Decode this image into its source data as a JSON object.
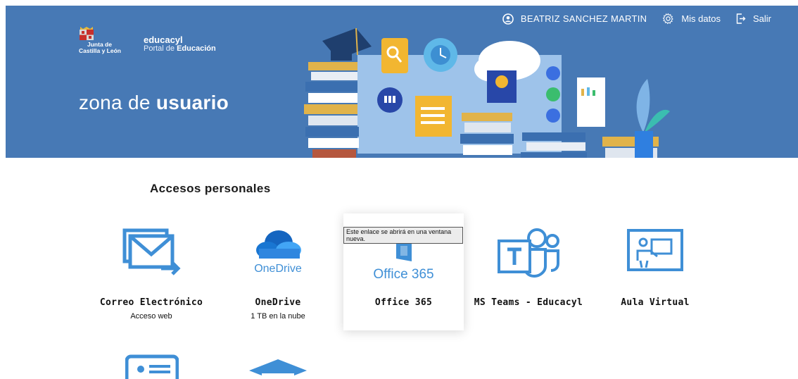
{
  "header": {
    "user": {
      "name": "BEATRIZ SANCHEZ MARTIN"
    },
    "nav": {
      "mis_datos": "Mis datos",
      "salir": "Salir"
    },
    "logo": {
      "jcyl_line1": "Junta de",
      "jcyl_line2": "Castilla y León",
      "brand": "educacyl",
      "portal_prefix": "Portal de ",
      "portal_bold": "Educación"
    },
    "zone_title_regular": "zona de ",
    "zone_title_bold": "usuario"
  },
  "section": {
    "title": "Accesos personales"
  },
  "tiles": [
    {
      "title": "Correo Electrónico",
      "subtitle": "Acceso web",
      "icon": "mail-icon"
    },
    {
      "title": "OneDrive",
      "subtitle": "1 TB en la nube",
      "icon": "onedrive-icon",
      "logo_text": "OneDrive"
    },
    {
      "title": "Office 365",
      "subtitle": "",
      "icon": "office-icon",
      "logo_text": "Office 365"
    },
    {
      "title": "MS Teams - Educacyl",
      "subtitle": "",
      "icon": "teams-icon"
    },
    {
      "title": "Aula Virtual",
      "subtitle": "",
      "icon": "virtual-classroom-icon"
    }
  ],
  "tooltip": {
    "text": "Este enlace se abrirá en una ventana nueva."
  },
  "colors": {
    "header_bg": "#4779b5",
    "icon_blue": "#3f8fd6",
    "tile_text": "#111111"
  }
}
